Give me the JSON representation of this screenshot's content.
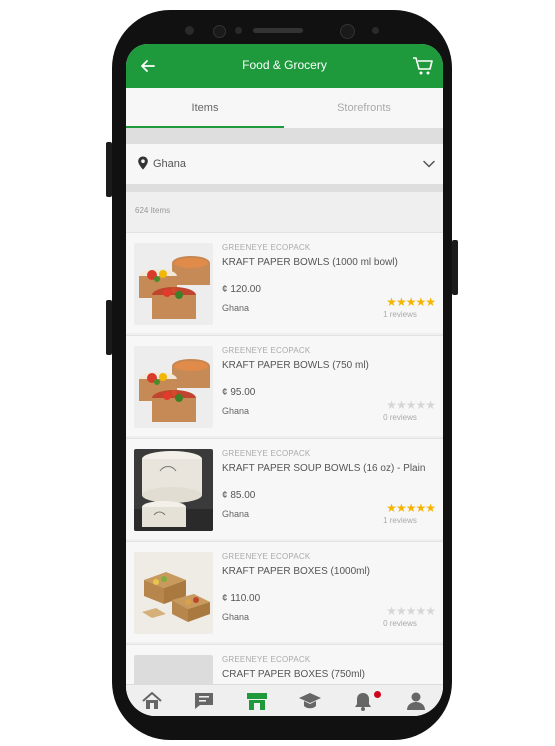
{
  "header": {
    "title": "Food & Grocery",
    "back_icon": "arrow-left-icon",
    "cart_icon": "cart-icon",
    "color": "#1e9a3c"
  },
  "tabs": [
    {
      "label": "Items",
      "active": true
    },
    {
      "label": "Storefronts",
      "active": false
    }
  ],
  "location": {
    "value": "Ghana",
    "icon": "location-pin-icon",
    "dropdown_icon": "chevron-down-icon"
  },
  "results": {
    "count_label": "624 Items"
  },
  "products": [
    {
      "brand": "GREENEYE ECOPACK",
      "name": "KRAFT PAPER BOWLS (1000 ml bowl)",
      "price": "¢ 120.00",
      "country": "Ghana",
      "rating": 5,
      "reviews": "1 reviews"
    },
    {
      "brand": "GREENEYE ECOPACK",
      "name": "KRAFT PAPER BOWLS (750 ml)",
      "price": "¢ 95.00",
      "country": "Ghana",
      "rating": 0,
      "reviews": "0 reviews"
    },
    {
      "brand": "GREENEYE ECOPACK",
      "name": "KRAFT PAPER SOUP BOWLS (16 oz) - Plain",
      "price": "¢ 85.00",
      "country": "Ghana",
      "rating": 5,
      "reviews": "1 reviews"
    },
    {
      "brand": "GREENEYE ECOPACK",
      "name": "KRAFT PAPER BOXES (1000ml)",
      "price": "¢ 110.00",
      "country": "Ghana",
      "rating": 0,
      "reviews": "0 reviews"
    },
    {
      "brand": "GREENEYE ECOPACK",
      "name": "CRAFT PAPER BOXES (750ml)"
    }
  ],
  "bottom_nav": [
    {
      "icon": "home-icon",
      "active": false
    },
    {
      "icon": "chat-icon",
      "active": false
    },
    {
      "icon": "storefront-icon",
      "active": true
    },
    {
      "icon": "graduation-cap-icon",
      "active": false
    },
    {
      "icon": "bell-icon",
      "active": false,
      "badge": true
    },
    {
      "icon": "profile-icon",
      "active": false
    }
  ]
}
